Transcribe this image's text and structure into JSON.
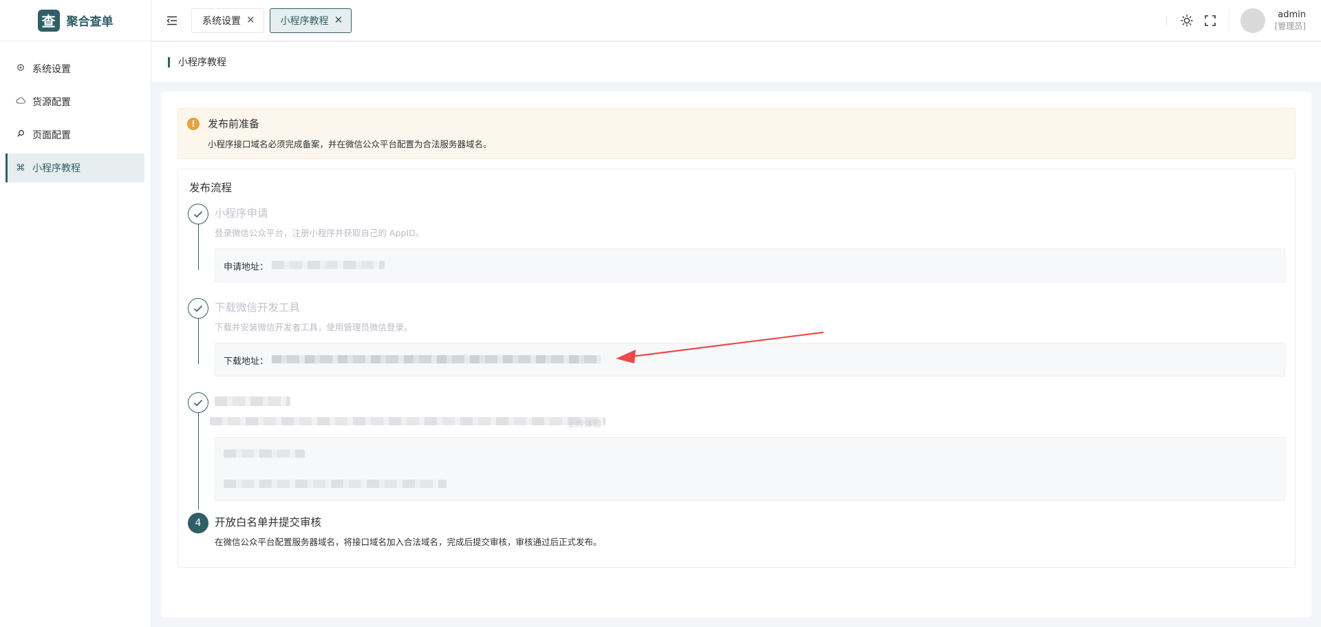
{
  "brand": {
    "logo_glyph": "查",
    "name": "聚合查单",
    "color": "#2f5f67"
  },
  "sidebar": {
    "items": [
      {
        "label": "系统设置",
        "icon": "gear-icon",
        "active": false
      },
      {
        "label": "货源配置",
        "icon": "cloud-icon",
        "active": false
      },
      {
        "label": "页面配置",
        "icon": "search-icon",
        "active": false
      },
      {
        "label": "小程序教程",
        "icon": "command-icon",
        "active": true
      }
    ]
  },
  "header": {
    "tabs": [
      {
        "label": "系统设置",
        "active": false
      },
      {
        "label": "小程序教程",
        "active": true
      }
    ],
    "user": {
      "name": "admin",
      "role": "[管理员]"
    }
  },
  "breadcrumb": {
    "current": "小程序教程"
  },
  "alert": {
    "icon": "warning-icon",
    "title": "发布前准备",
    "desc": "小程序接口域名必须完成备案，并在微信公众平台配置为合法服务器域名。",
    "color": "#e6a23c"
  },
  "flow": {
    "title": "发布流程",
    "steps": [
      {
        "status": "done",
        "title": "小程序申请",
        "desc": "登录微信公众平台，注册小程序并获取自己的 AppID。",
        "box_label": "申请地址："
      },
      {
        "status": "done",
        "title": "下载微信开发工具",
        "desc": "下载并安装微信开发者工具，使用管理员微信登录。",
        "box_label": "下载地址："
      },
      {
        "status": "done",
        "title": "",
        "desc": "上传体验",
        "box_label": ""
      },
      {
        "status": "current",
        "number": "4",
        "title": "开放白名单并提交审核",
        "desc": "在微信公众平台配置服务器域名，将接口域名加入合法域名，完成后提交审核，审核通过后正式发布。"
      }
    ]
  },
  "annotation": {
    "color": "#f04848"
  }
}
